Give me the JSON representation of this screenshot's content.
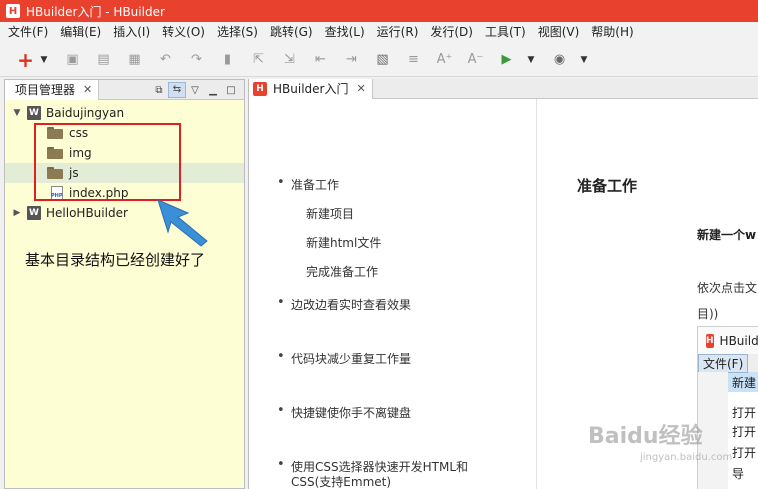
{
  "window": {
    "title": "HBuilder入门 - HBuilder",
    "app_icon": "H"
  },
  "menubar": [
    "文件(F)",
    "编辑(E)",
    "插入(I)",
    "转义(O)",
    "选择(S)",
    "跳转(G)",
    "查找(L)",
    "运行(R)",
    "发行(D)",
    "工具(T)",
    "视图(V)",
    "帮助(H)"
  ],
  "toolbar": {
    "icons": [
      "new-icon",
      "save-icon",
      "save-all-icon",
      "open-icon",
      "undo-icon",
      "redo-icon",
      "bookmark-icon",
      "export-icon",
      "import-icon",
      "jump-start-icon",
      "jump-end-icon",
      "comment-icon",
      "format-icon",
      "font-increase-icon",
      "font-decrease-icon",
      "run-icon",
      "browser-icon"
    ],
    "new_glyph": "+"
  },
  "project_panel": {
    "tab_label": "项目管理器",
    "tree": [
      {
        "label": "Baidujingyan",
        "type": "project",
        "expanded": true
      },
      {
        "label": "css",
        "type": "folder"
      },
      {
        "label": "img",
        "type": "folder"
      },
      {
        "label": "js",
        "type": "folder",
        "selected": true
      },
      {
        "label": "index.php",
        "type": "php-file"
      },
      {
        "label": "HelloHBuilder",
        "type": "project",
        "expanded": false
      }
    ],
    "annotation": "基本目录结构已经创建好了",
    "colors": {
      "panel_bg": "#fefed5",
      "highlight": "#e02020",
      "arrow": "#3a8fd6"
    }
  },
  "editor": {
    "tab_label": "HBuilder入门",
    "outline": [
      {
        "label": "准备工作",
        "level": 0
      },
      {
        "label": "新建项目",
        "level": 1
      },
      {
        "label": "新建html文件",
        "level": 1
      },
      {
        "label": "完成准备工作",
        "level": 1
      },
      {
        "label": "边改边看实时查看效果",
        "level": 0
      },
      {
        "label": "代码块减少重复工作量",
        "level": 0
      },
      {
        "label": "快捷键使你手不离键盘",
        "level": 0
      },
      {
        "label": "使用CSS选择器快速开发HTML和",
        "level": 0
      },
      {
        "label": "CSS(支持Emmet)",
        "level": 0
      }
    ],
    "content": {
      "title": "准备工作",
      "subtitle": "新建一个w",
      "line1": "依次点击文",
      "line2": "目))"
    },
    "embedded": {
      "title": "HBuilde",
      "menu": "文件(F)",
      "rows": [
        "新建",
        "打开",
        "打开",
        "打开"
      ],
      "last_row": "导"
    }
  },
  "watermark": {
    "text": "Baidu经验",
    "url": "jingyan.baidu.com"
  }
}
